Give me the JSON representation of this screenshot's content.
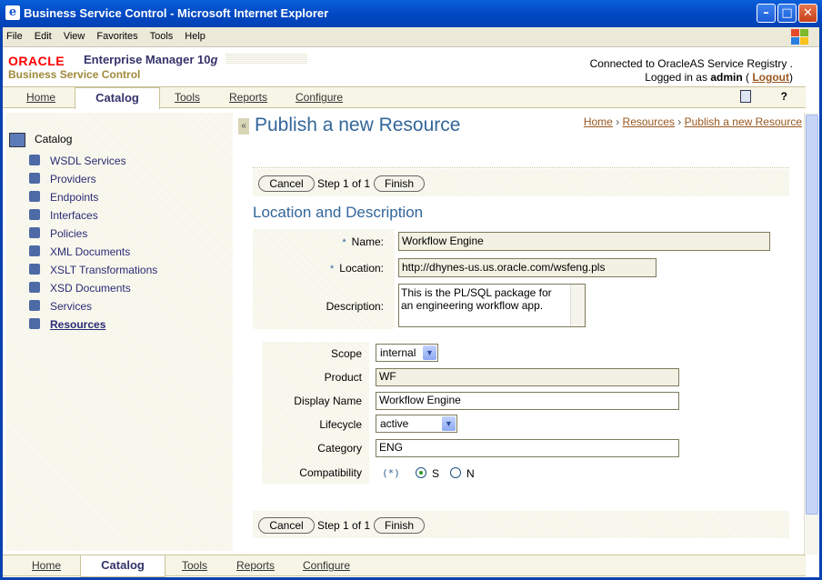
{
  "window": {
    "title": "Business Service Control - Microsoft Internet Explorer"
  },
  "menu": [
    "File",
    "Edit",
    "View",
    "Favorites",
    "Tools",
    "Help"
  ],
  "header": {
    "oracle_logo": "ORACLE",
    "product": "Enterprise Manager 10",
    "product_version_suffix": "g",
    "app_name": "Business Service Control",
    "connection": "Connected to OracleAS Service Registry .",
    "logged_prefix": "Logged in as",
    "user": "admin",
    "logout_open": "(",
    "logout": "Logout",
    "logout_close": ")",
    "help": "?"
  },
  "tabs": [
    "Home",
    "Catalog",
    "Tools",
    "Reports",
    "Configure"
  ],
  "sidebar": {
    "root": "Catalog",
    "items": [
      "WSDL Services",
      "Providers",
      "Endpoints",
      "Interfaces",
      "Policies",
      "XML Documents",
      "XSLT Transformations",
      "XSD Documents",
      "Services",
      "Resources"
    ]
  },
  "page": {
    "title": "Publish a new Resource",
    "breadcrumbs": [
      "Home",
      "Resources",
      "Publish a new Resource"
    ],
    "crumb_sep": "›",
    "section": "Location and Description"
  },
  "steps": {
    "cancel": "Cancel",
    "step": "Step 1 of 1",
    "finish": "Finish"
  },
  "form": {
    "name_label": "Name:",
    "name_value": "Workflow Engine",
    "location_label": "Location:",
    "location_value": "http://dhynes-us.us.oracle.com/wsfeng.pls",
    "description_label": "Description:",
    "description_value": "This is the PL/SQL package for an engineering workflow app.",
    "required_mark": "*",
    "scope_label": "Scope",
    "scope_value": "internal",
    "product_label": "Product",
    "product_value": "WF",
    "display_name_label": "Display Name",
    "display_name_value": "Workflow Engine",
    "lifecycle_label": "Lifecycle",
    "lifecycle_value": "active",
    "category_label": "Category",
    "category_value": "ENG",
    "compat_label": "Compatibility",
    "compat_marker": "(*)",
    "compat_s": "S",
    "compat_n": "N"
  }
}
